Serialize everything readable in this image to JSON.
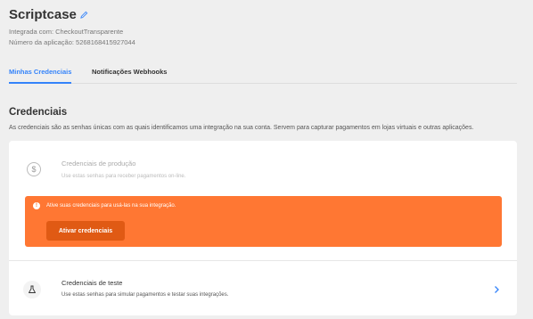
{
  "header": {
    "app_name": "Scriptcase",
    "integration_line": "Integrada com: CheckoutTransparente",
    "app_number_line": "Número da aplicação: 5268168415927044"
  },
  "tabs": [
    {
      "label": "Minhas Credenciais",
      "active": true
    },
    {
      "label": "Notificações Webhooks",
      "active": false
    }
  ],
  "section": {
    "title": "Credenciais",
    "description": "As credenciais são as senhas únicas com as quais identificamos uma integração na sua conta. Servem para capturar pagamentos em lojas virtuais e outras aplicações."
  },
  "production": {
    "title": "Credenciais de produção",
    "subtitle": "Use estas senhas para receber pagamentos on-line.",
    "icon": "dollar-circle-icon"
  },
  "banner": {
    "message": "Ative suas credenciais para usá-las na sua integração.",
    "button_label": "Ativar credenciais",
    "color": "#ff7733",
    "button_color": "#e05a14"
  },
  "test": {
    "title": "Credenciais de teste",
    "subtitle": "Use estas senhas para simular pagamentos e testar suas integrações.",
    "icon": "flask-icon"
  },
  "colors": {
    "accent": "#3483fa",
    "background": "#efefef"
  }
}
